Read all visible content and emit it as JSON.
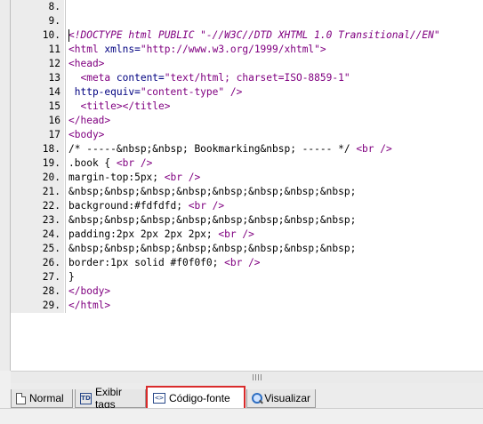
{
  "editor": {
    "lines": [
      {
        "num": "8.",
        "tokens": []
      },
      {
        "num": "9.",
        "tokens": []
      },
      {
        "num": "10.",
        "tokens": [
          {
            "t": "<!DOCTYPE html PUBLIC \"-//W3C//DTD XHTML 1.0 Transitional//EN\"",
            "c": "k-doctype"
          }
        ]
      },
      {
        "num": "11",
        "tokens": [
          {
            "t": "<html",
            "c": "k-tag"
          },
          {
            "t": " xmlns=",
            "c": "k-attr"
          },
          {
            "t": "\"http://www.w3.org/1999/xhtml\"",
            "c": "k-val"
          },
          {
            "t": ">",
            "c": "k-tag"
          }
        ]
      },
      {
        "num": "12",
        "tokens": [
          {
            "t": "<head>",
            "c": "k-tag"
          }
        ]
      },
      {
        "num": "13",
        "tokens": [
          {
            "t": "  <meta",
            "c": "k-tag"
          },
          {
            "t": " content=",
            "c": "k-attr"
          },
          {
            "t": "\"text/html; charset=ISO-8859-1\"",
            "c": "k-val"
          }
        ]
      },
      {
        "num": "14",
        "tokens": [
          {
            "t": " http-equiv=",
            "c": "k-attr"
          },
          {
            "t": "\"content-type\"",
            "c": "k-val"
          },
          {
            "t": " />",
            "c": "k-tag"
          }
        ]
      },
      {
        "num": "15",
        "tokens": [
          {
            "t": "  <title></title>",
            "c": "k-tag"
          }
        ]
      },
      {
        "num": "16",
        "tokens": [
          {
            "t": "</head>",
            "c": "k-tag"
          }
        ]
      },
      {
        "num": "17",
        "tokens": [
          {
            "t": "<body>",
            "c": "k-tag"
          }
        ]
      },
      {
        "num": "18.",
        "tokens": [
          {
            "t": "/* -----&nbsp;&nbsp; Bookmarking&nbsp; ----- */ ",
            "c": "k-text"
          },
          {
            "t": "<br />",
            "c": "k-tag"
          }
        ]
      },
      {
        "num": "19.",
        "tokens": [
          {
            "t": ".book { ",
            "c": "k-text"
          },
          {
            "t": "<br />",
            "c": "k-tag"
          }
        ]
      },
      {
        "num": "20.",
        "tokens": [
          {
            "t": "margin-top:5px; ",
            "c": "k-text"
          },
          {
            "t": "<br />",
            "c": "k-tag"
          }
        ]
      },
      {
        "num": "21.",
        "tokens": [
          {
            "t": "&nbsp;&nbsp;&nbsp;&nbsp;&nbsp;&nbsp;&nbsp;&nbsp;",
            "c": "k-text"
          }
        ]
      },
      {
        "num": "22.",
        "tokens": [
          {
            "t": "background:#fdfdfd; ",
            "c": "k-text"
          },
          {
            "t": "<br />",
            "c": "k-tag"
          }
        ]
      },
      {
        "num": "23.",
        "tokens": [
          {
            "t": "&nbsp;&nbsp;&nbsp;&nbsp;&nbsp;&nbsp;&nbsp;&nbsp;",
            "c": "k-text"
          }
        ]
      },
      {
        "num": "24.",
        "tokens": [
          {
            "t": "padding:2px 2px 2px 2px; ",
            "c": "k-text"
          },
          {
            "t": "<br />",
            "c": "k-tag"
          }
        ]
      },
      {
        "num": "25.",
        "tokens": [
          {
            "t": "&nbsp;&nbsp;&nbsp;&nbsp;&nbsp;&nbsp;&nbsp;&nbsp;",
            "c": "k-text"
          }
        ]
      },
      {
        "num": "26.",
        "tokens": [
          {
            "t": "border:1px solid #f0f0f0; ",
            "c": "k-text"
          },
          {
            "t": "<br />",
            "c": "k-tag"
          }
        ]
      },
      {
        "num": "27.",
        "tokens": [
          {
            "t": "}",
            "c": "k-text"
          }
        ]
      },
      {
        "num": "28.",
        "tokens": [
          {
            "t": "</body>",
            "c": "k-tag"
          }
        ]
      },
      {
        "num": "29.",
        "tokens": [
          {
            "t": "</html>",
            "c": "k-tag"
          }
        ]
      }
    ]
  },
  "tabs": [
    {
      "label": "Normal",
      "icon": "page-icon"
    },
    {
      "label": "Exibir tags",
      "icon": "td-icon",
      "icon_text": "TD"
    },
    {
      "label": "Código-fonte",
      "icon": "code-icon",
      "icon_text": "<>",
      "active": true
    },
    {
      "label": "Visualizar",
      "icon": "magnifier-icon"
    }
  ],
  "colors": {
    "tag": "#800080",
    "attribute": "#000080",
    "active_highlight": "#d92b2b"
  }
}
